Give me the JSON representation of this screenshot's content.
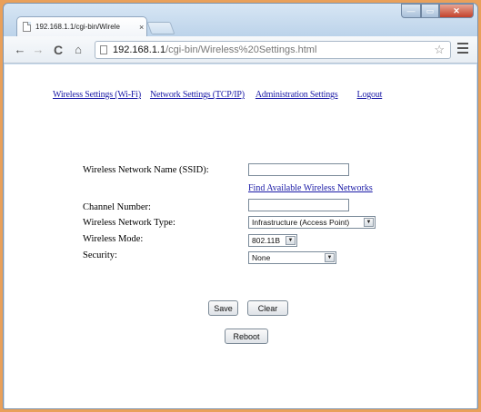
{
  "browser": {
    "tab_title": "192.168.1.1/cgi-bin/Wirele",
    "tab_close": "×",
    "url_host": "192.168.1.1",
    "url_path": "/cgi-bin/Wireless%20Settings.html",
    "win_min": "—",
    "win_max": "▭",
    "win_close": "✕",
    "back_icon": "←",
    "forward_icon": "→",
    "reload_icon": "C",
    "home_icon": "⌂",
    "star_icon": "☆"
  },
  "nav": {
    "wireless": "Wireless Settings (Wi-Fi)",
    "network": "Network Settings (TCP/IP)",
    "admin": "Administration Settings",
    "logout": "Logout"
  },
  "form": {
    "ssid_label": "Wireless Network Name (SSID):",
    "ssid_value": "",
    "find_link": "Find Available Wireless Networks",
    "channel_label": "Channel Number:",
    "channel_value": "",
    "type_label": "Wireless Network Type:",
    "type_value": "Infrastructure (Access Point)",
    "mode_label": "Wireless Mode:",
    "mode_value": "802.11B",
    "security_label": "Security:",
    "security_value": "None"
  },
  "buttons": {
    "save": "Save",
    "clear": "Clear",
    "reboot": "Reboot"
  },
  "colors": {
    "link": "#1a1aa6",
    "frame_accent": "#e9a05a"
  }
}
